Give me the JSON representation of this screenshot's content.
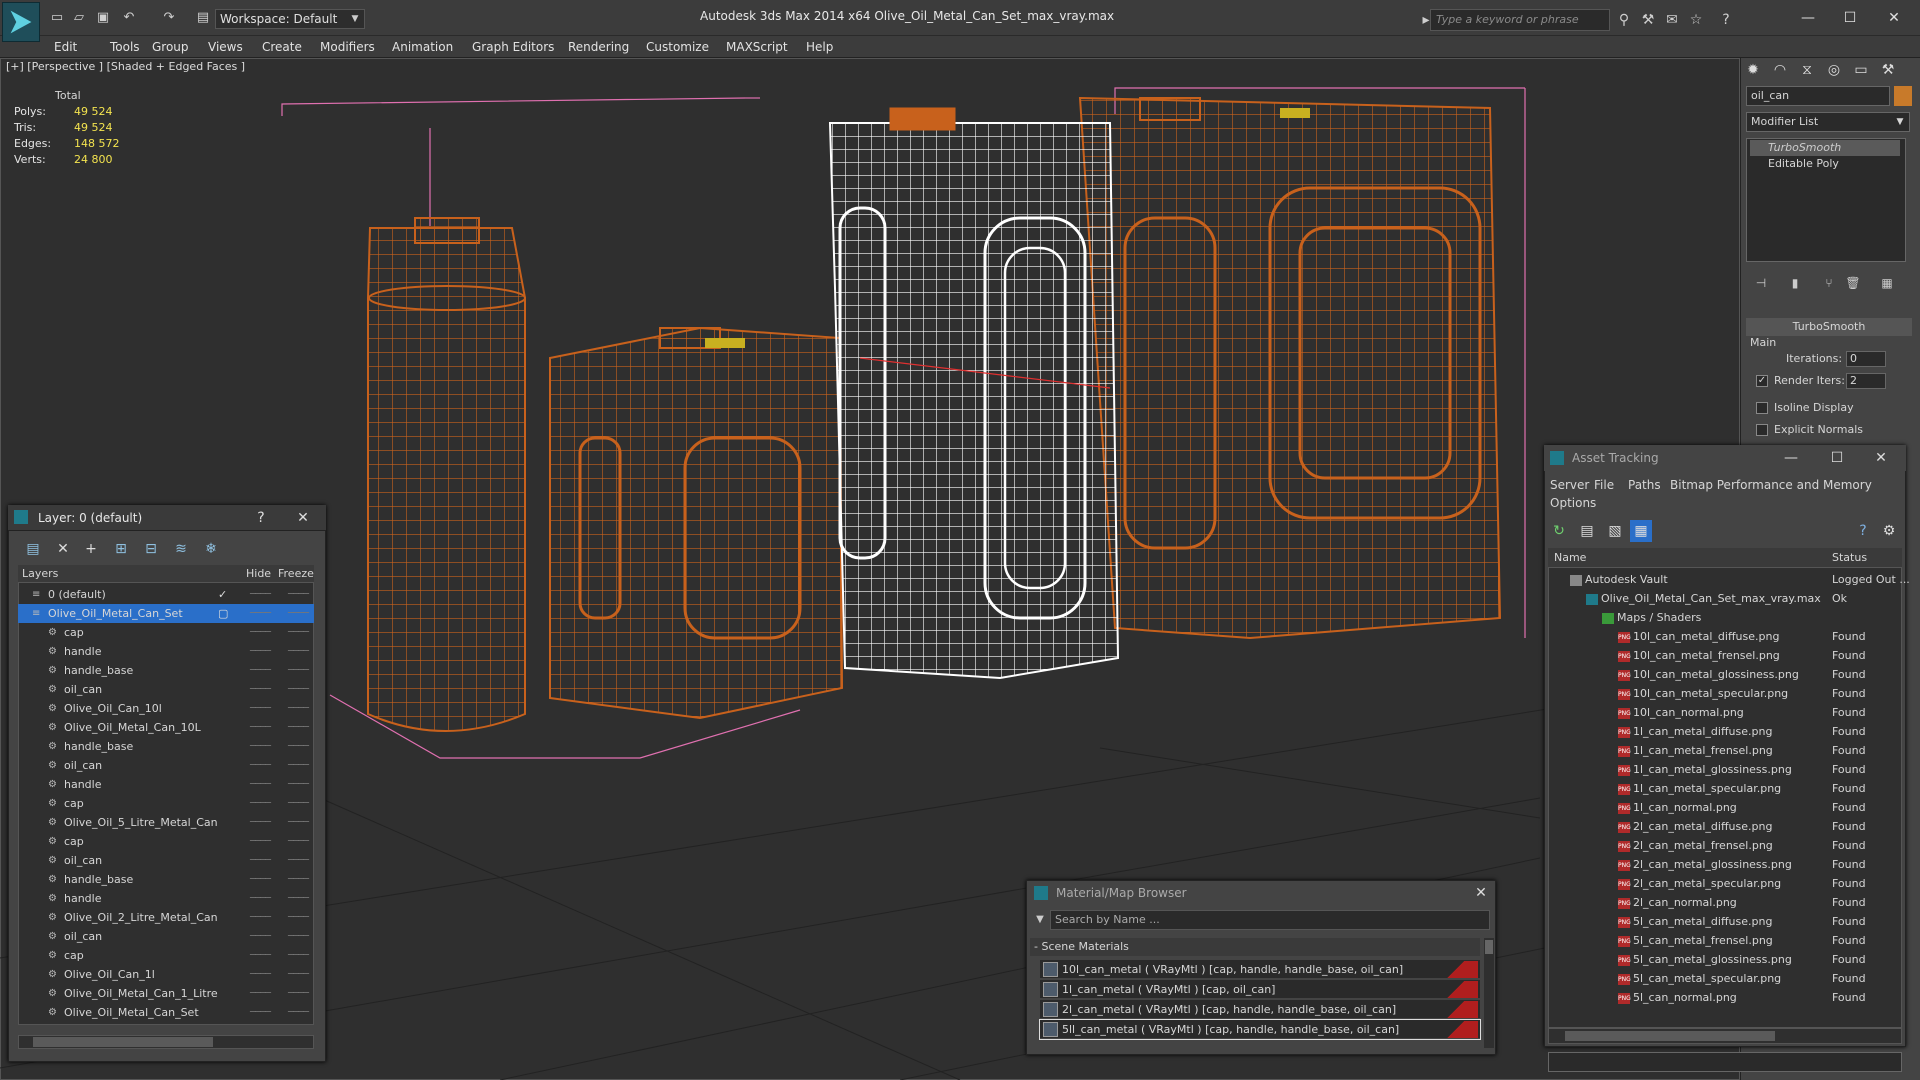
{
  "window": {
    "title": "Autodesk 3ds Max  2014 x64       Olive_Oil_Metal_Can_Set_max_vray.max",
    "workspace": "Workspace: Default",
    "search_placeholder": "Type a keyword or phrase"
  },
  "menu": [
    "Edit",
    "Tools",
    "Group",
    "Views",
    "Create",
    "Modifiers",
    "Animation",
    "Graph Editors",
    "Rendering",
    "Customize",
    "MAXScript",
    "Help"
  ],
  "viewport": {
    "label": "[+] [Perspective ] [Shaded + Edged Faces ]",
    "stats": {
      "header": "Total",
      "rows": [
        {
          "label": "Polys:",
          "value": "49 524"
        },
        {
          "label": "Tris:",
          "value": "49 524"
        },
        {
          "label": "Edges:",
          "value": "148 572"
        },
        {
          "label": "Verts:",
          "value": "24 800"
        }
      ]
    }
  },
  "command_panel": {
    "object_name": "oil_can",
    "modifier_list": "Modifier List",
    "stack": [
      "TurboSmooth",
      "Editable Poly"
    ],
    "rollout_title": "TurboSmooth",
    "section_main": "Main",
    "iterations_label": "Iterations:",
    "iterations_value": "0",
    "render_iters_label": "Render Iters:",
    "render_iters_value": "2",
    "isoline_label": "Isoline Display",
    "explicit_normals_label": "Explicit Normals"
  },
  "layer_dialog": {
    "title": "Layer: 0 (default)",
    "help": "?",
    "columns": {
      "layers": "Layers",
      "hide": "Hide",
      "freeze": "Freeze"
    },
    "rows": [
      {
        "name": "0 (default)",
        "level": 1,
        "type": "layer",
        "selected": false
      },
      {
        "name": "Olive_Oil_Metal_Can_Set",
        "level": 1,
        "type": "layer",
        "selected": true
      },
      {
        "name": "cap",
        "level": 2,
        "type": "obj"
      },
      {
        "name": "handle",
        "level": 2,
        "type": "obj"
      },
      {
        "name": "handle_base",
        "level": 2,
        "type": "obj"
      },
      {
        "name": "oil_can",
        "level": 2,
        "type": "obj"
      },
      {
        "name": "Olive_Oil_Can_10l",
        "level": 2,
        "type": "obj"
      },
      {
        "name": "Olive_Oil_Metal_Can_10L",
        "level": 2,
        "type": "obj"
      },
      {
        "name": "handle_base",
        "level": 2,
        "type": "obj"
      },
      {
        "name": "oil_can",
        "level": 2,
        "type": "obj"
      },
      {
        "name": "handle",
        "level": 2,
        "type": "obj"
      },
      {
        "name": "cap",
        "level": 2,
        "type": "obj"
      },
      {
        "name": "Olive_Oil_5_Litre_Metal_Can",
        "level": 2,
        "type": "obj"
      },
      {
        "name": "cap",
        "level": 2,
        "type": "obj"
      },
      {
        "name": "oil_can",
        "level": 2,
        "type": "obj"
      },
      {
        "name": "handle_base",
        "level": 2,
        "type": "obj"
      },
      {
        "name": "handle",
        "level": 2,
        "type": "obj"
      },
      {
        "name": "Olive_Oil_2_Litre_Metal_Can",
        "level": 2,
        "type": "obj"
      },
      {
        "name": "oil_can",
        "level": 2,
        "type": "obj"
      },
      {
        "name": "cap",
        "level": 2,
        "type": "obj"
      },
      {
        "name": "Olive_Oil_Can_1l",
        "level": 2,
        "type": "obj"
      },
      {
        "name": "Olive_Oil_Metal_Can_1_Litre",
        "level": 2,
        "type": "obj"
      },
      {
        "name": "Olive_Oil_Metal_Can_Set",
        "level": 2,
        "type": "obj"
      }
    ]
  },
  "asset_tracking": {
    "title": "Asset Tracking",
    "menu": [
      "Server",
      "File",
      "Paths",
      "Bitmap Performance and Memory",
      "Options"
    ],
    "columns": {
      "name": "Name",
      "status": "Status"
    },
    "rows": [
      {
        "name": "Autodesk Vault",
        "status": "Logged Out ...",
        "level": 1,
        "kind": "vault"
      },
      {
        "name": "Olive_Oil_Metal_Can_Set_max_vray.max",
        "status": "Ok",
        "level": 2,
        "kind": "max"
      },
      {
        "name": "Maps / Shaders",
        "status": "",
        "level": 3,
        "kind": "folder"
      },
      {
        "name": "10l_can_metal_diffuse.png",
        "status": "Found",
        "level": 4,
        "kind": "png"
      },
      {
        "name": "10l_can_metal_frensel.png",
        "status": "Found",
        "level": 4,
        "kind": "png"
      },
      {
        "name": "10l_can_metal_glossiness.png",
        "status": "Found",
        "level": 4,
        "kind": "png"
      },
      {
        "name": "10l_can_metal_specular.png",
        "status": "Found",
        "level": 4,
        "kind": "png"
      },
      {
        "name": "10l_can_normal.png",
        "status": "Found",
        "level": 4,
        "kind": "png"
      },
      {
        "name": "1l_can_metal_diffuse.png",
        "status": "Found",
        "level": 4,
        "kind": "png"
      },
      {
        "name": "1l_can_metal_frensel.png",
        "status": "Found",
        "level": 4,
        "kind": "png"
      },
      {
        "name": "1l_can_metal_glossiness.png",
        "status": "Found",
        "level": 4,
        "kind": "png"
      },
      {
        "name": "1l_can_metal_specular.png",
        "status": "Found",
        "level": 4,
        "kind": "png"
      },
      {
        "name": "1l_can_normal.png",
        "status": "Found",
        "level": 4,
        "kind": "png"
      },
      {
        "name": "2l_can_metal_diffuse.png",
        "status": "Found",
        "level": 4,
        "kind": "png"
      },
      {
        "name": "2l_can_metal_frensel.png",
        "status": "Found",
        "level": 4,
        "kind": "png"
      },
      {
        "name": "2l_can_metal_glossiness.png",
        "status": "Found",
        "level": 4,
        "kind": "png"
      },
      {
        "name": "2l_can_metal_specular.png",
        "status": "Found",
        "level": 4,
        "kind": "png"
      },
      {
        "name": "2l_can_normal.png",
        "status": "Found",
        "level": 4,
        "kind": "png"
      },
      {
        "name": "5l_can_metal_diffuse.png",
        "status": "Found",
        "level": 4,
        "kind": "png"
      },
      {
        "name": "5l_can_metal_frensel.png",
        "status": "Found",
        "level": 4,
        "kind": "png"
      },
      {
        "name": "5l_can_metal_glossiness.png",
        "status": "Found",
        "level": 4,
        "kind": "png"
      },
      {
        "name": "5l_can_metal_specular.png",
        "status": "Found",
        "level": 4,
        "kind": "png"
      },
      {
        "name": "5l_can_normal.png",
        "status": "Found",
        "level": 4,
        "kind": "png"
      }
    ]
  },
  "material_browser": {
    "title": "Material/Map Browser",
    "search_placeholder": "Search by Name ...",
    "group": "- Scene Materials",
    "rows": [
      "10l_can_metal  ( VRayMtl ) [cap, handle, handle_base, oil_can]",
      "1l_can_metal  ( VRayMtl ) [cap, oil_can]",
      "2l_can_metal  ( VRayMtl ) [cap, handle, handle_base, oil_can]",
      "5ll_can_metal  ( VRayMtl ) [cap, handle, handle_base, oil_can]"
    ]
  },
  "colors": {
    "wire_orange": "#c8611c",
    "wire_white": "#ffffff",
    "bbox_pink": "#e070b0",
    "stats_yellow": "#f3e34f",
    "selection_blue": "#2a6fc9"
  }
}
